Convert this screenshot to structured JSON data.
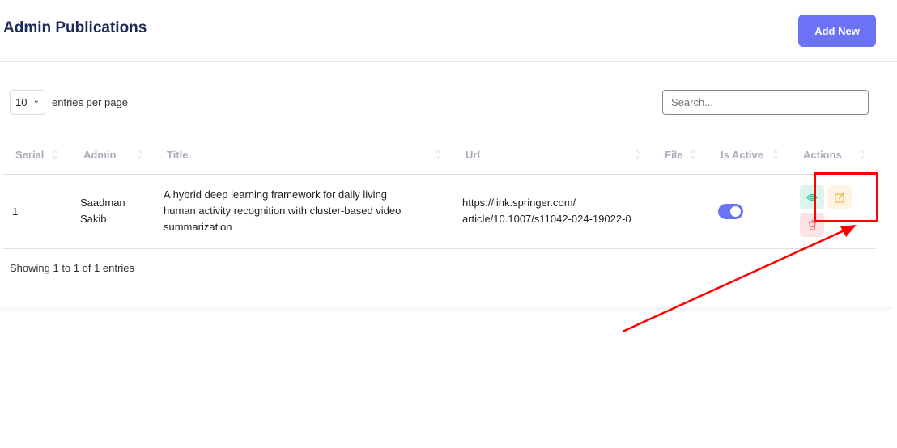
{
  "header": {
    "title": "Admin Publications",
    "add_label": "Add New"
  },
  "controls": {
    "page_size": "10",
    "entries_label": "entries per page",
    "search_placeholder": "Search..."
  },
  "table": {
    "columns": [
      "Serial",
      "Admin",
      "Title",
      "Url",
      "File",
      "Is Active",
      "Actions"
    ],
    "rows": [
      {
        "serial": "1",
        "admin_line1": "Saadman",
        "admin_line2": "Sakib",
        "title_lines": [
          "A hybrid deep learning framework for daily living",
          "human activity recognition with cluster-based video",
          "summarization"
        ],
        "url_lines": [
          "https://link.springer.com/",
          "article/10.1007/s11042-024-19022-0"
        ],
        "is_active": true
      }
    ]
  },
  "footer": {
    "info": "Showing 1 to 1 of 1 entries"
  },
  "colors": {
    "accent": "#6c72f6",
    "view": "#1bc5a0",
    "edit": "#f6b94a",
    "delete": "#f1616f",
    "annotation": "#ff0000"
  }
}
